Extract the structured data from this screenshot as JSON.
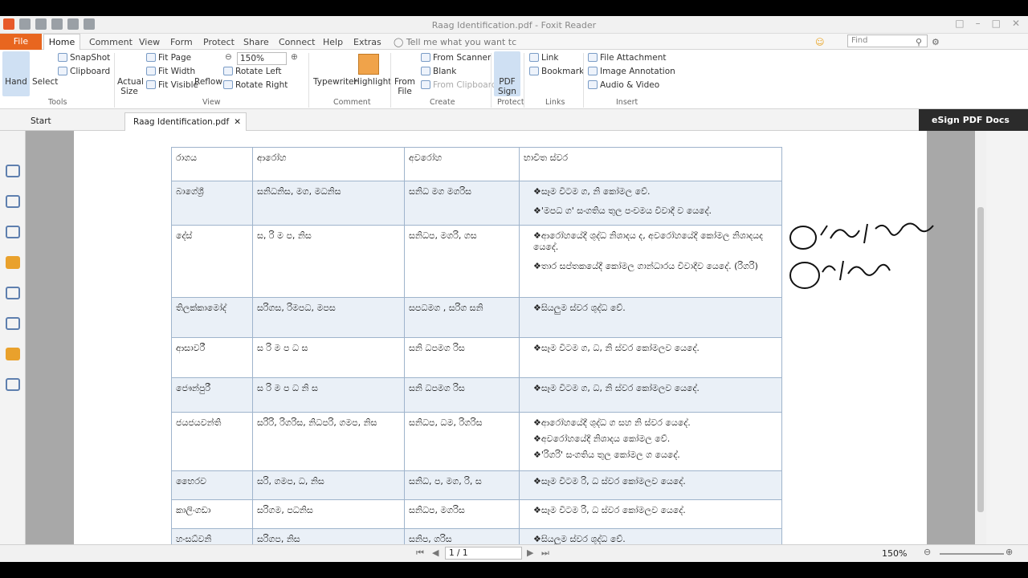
{
  "window": {
    "title": "Raag Identification.pdf - Foxit Reader"
  },
  "menu": {
    "file": "File",
    "items": [
      "Home",
      "Comment",
      "View",
      "Form",
      "Protect",
      "Share",
      "Connect",
      "Help",
      "Extras"
    ],
    "tell_me": "Tell me what you want tc",
    "find_placeholder": "Find"
  },
  "ribbon": {
    "hand": "Hand",
    "select": "Select",
    "snapshot": "SnapShot",
    "clipboard": "Clipboard",
    "actual_size_1": "Actual",
    "actual_size_2": "Size",
    "fit_page": "Fit Page",
    "fit_width": "Fit Width",
    "fit_visible": "Fit Visible",
    "reflow": "Reflow",
    "zoom": "150%",
    "rotate_left": "Rotate Left",
    "rotate_right": "Rotate Right",
    "typewriter": "Typewriter",
    "highlight": "Highlight",
    "from_file_1": "From",
    "from_file_2": "File",
    "from_scanner": "From Scanner",
    "blank": "Blank",
    "from_clipboard": "From Clipboard",
    "pdf_sign_1": "PDF",
    "pdf_sign_2": "Sign",
    "link": "Link",
    "bookmark": "Bookmark",
    "file_attachment": "File Attachment",
    "image_annotation": "Image Annotation",
    "audio_video": "Audio & Video",
    "groups": {
      "tools": "Tools",
      "view": "View",
      "comment": "Comment",
      "create": "Create",
      "protect": "Protect",
      "links": "Links",
      "insert": "Insert"
    }
  },
  "tabs": {
    "start": "Start",
    "doc": "Raag Identification.pdf",
    "esign": "eSign PDF Docs"
  },
  "table": {
    "headers": [
      "රාගය",
      "ආරෝහ",
      "අවරෝහ",
      "භාවිත ස්වර"
    ],
    "rows": [
      {
        "name": "බාගේශ්‍රී",
        "aroha": "සනිධනිස, මග, මධනිස",
        "avaroha": "සනිධ මග මගරිස",
        "notes": [
          "සෑම විටම ග, නි කෝමල වේ.",
          "'මපධ ග' සංගතිය තුල පංචමය විවාදී ව යෙදේ."
        ]
      },
      {
        "name": "දේස්",
        "aroha": "ස, රි ම ප, නිස",
        "avaroha": "සනිධප, මගරි, ගස",
        "notes": [
          "ආරෝහයේදී ශුද්ධ නිශාදය ද, අවරෝහයේදී කෝමල නිශාදයද යෙදේ.",
          "තාර සප්තකයේදී කෝමල ගාන්ධාරය විවාදීව යෙදේ. (රිගරි)"
        ]
      },
      {
        "name": "තිලක්කාමෝද්",
        "aroha": "සරිගස, රිමපධ, මපස",
        "avaroha": "සපධමග , සරිග සනි",
        "notes": [
          "සියලුම ස්වර ශුද්ධ වේ."
        ]
      },
      {
        "name": "ආසාවරී",
        "aroha": "ස රි ම ප ධ ස",
        "avaroha": "සනි ධපමග රිස",
        "notes": [
          "සෑම විටම ග, ධ, නි ස්වර කෝමලව යෙදේ."
        ]
      },
      {
        "name": "ජෞන්පුරී",
        "aroha": "ස රි ම ප ධ නි ස",
        "avaroha": "සනි ධපමග රිස",
        "notes": [
          "සෑම විටම ග, ධ, නි ස්වර කෝමලව යෙදේ."
        ]
      },
      {
        "name": "ජයජයවන්ති",
        "aroha": "සරිරි, රිගරිස, නිධපරි, ගමප, නිස",
        "avaroha": "සනිධප, ධම, රිගරිස",
        "notes": [
          "ආරෝහයේදී ශුද්ධ ග සහ නි ස්වර යෙදේ.",
          "අවරෝහයේදී නිශාදය කෝමල වේ.",
          "'රිගරි' සංගතිය තුල කෝමල ග යෙදේ."
        ]
      },
      {
        "name": "භෛරව",
        "aroha": "සරි, ගමප, ධ, නිස",
        "avaroha": "සනිධ, ප, මග, රි, ස",
        "notes": [
          "සෑම විටම රි, ධ ස්වර කෝමලව යෙදේ."
        ]
      },
      {
        "name": "කාලිංගඩා",
        "aroha": "සරිගම, පධනිස",
        "avaroha": "සනිධප, මගරිස",
        "notes": [
          "සෑම විටම රි, ධ ස්වර කෝමලව යෙදේ."
        ]
      },
      {
        "name": "හංසධ්වනි",
        "aroha": "සරිගප, නිස",
        "avaroha": "සනිප, ගරිස",
        "notes": [
          "සියලුම ස්වර ශුද්ධ වේ."
        ]
      }
    ]
  },
  "status": {
    "page": "1 / 1",
    "zoom": "150%"
  }
}
